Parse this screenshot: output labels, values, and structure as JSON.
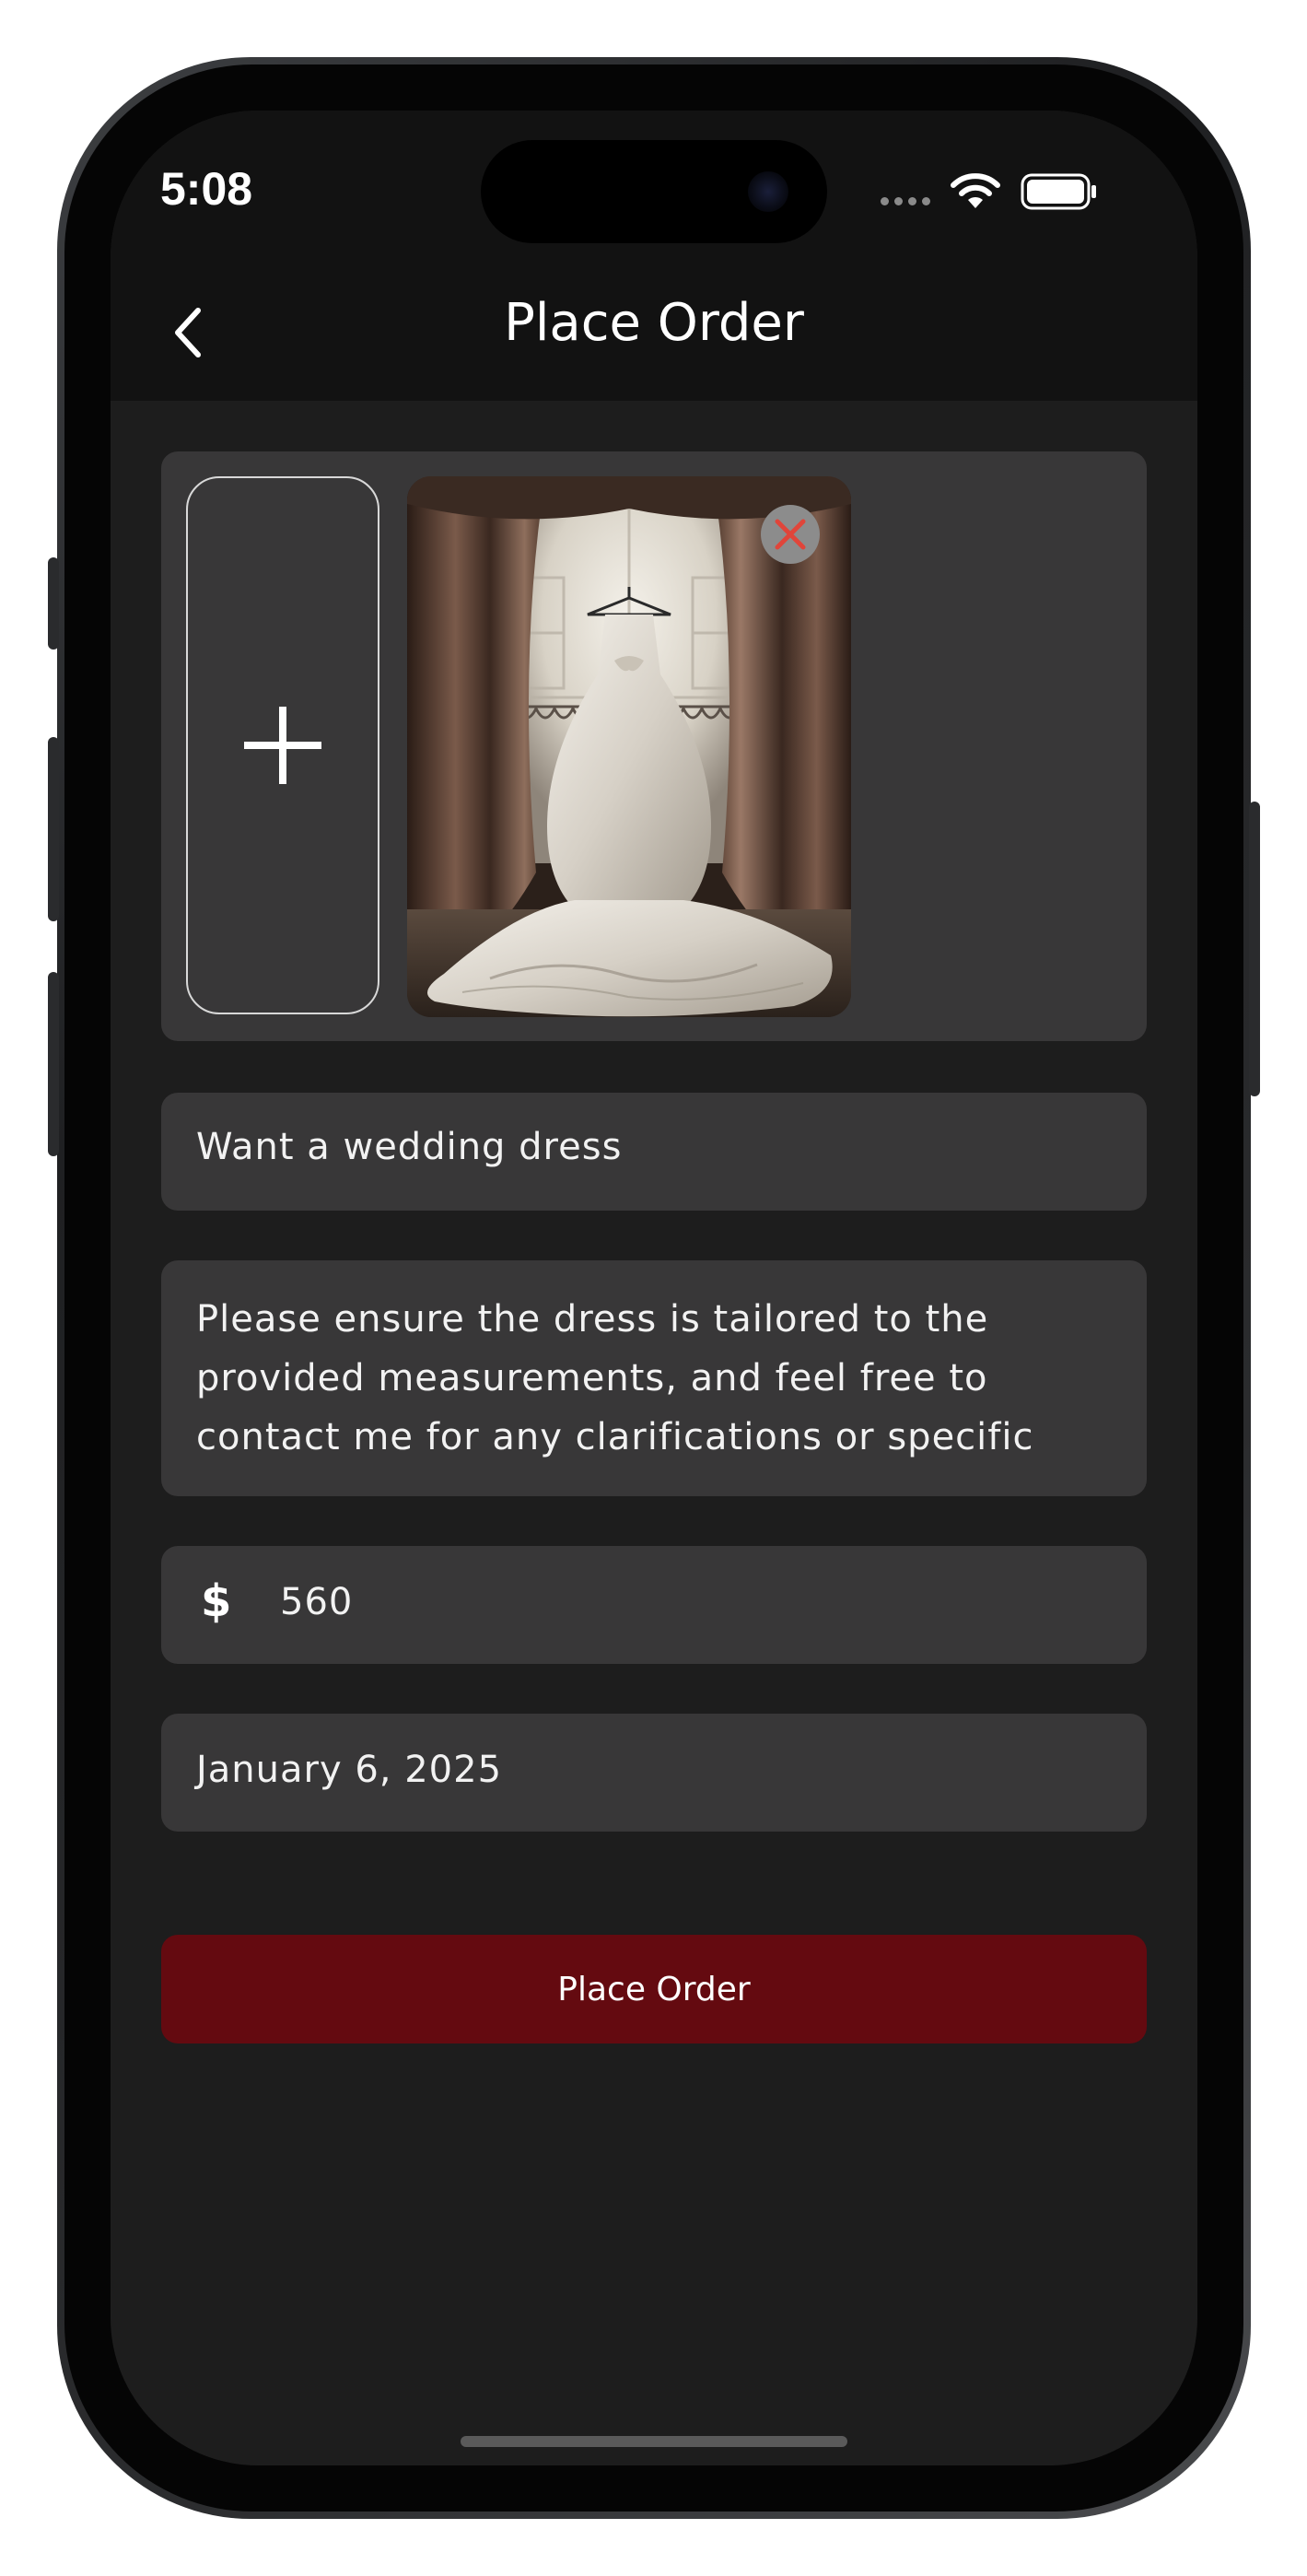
{
  "status_bar": {
    "time": "5:08",
    "icons": [
      "signal-dots-icon",
      "wifi-icon",
      "battery-icon"
    ]
  },
  "header": {
    "title": "Place Order",
    "back_icon": "chevron-left-icon"
  },
  "photos": {
    "add_icon": "plus-icon",
    "remove_icon": "close-icon",
    "items": [
      {
        "alt": "wedding dress hanging in front of arched window with curtains"
      }
    ]
  },
  "form": {
    "title_value": "Want a wedding dress",
    "description_value": "Please ensure the dress is tailored to the provided measurements, and feel free to contact me for any clarifications or specific",
    "currency_symbol": "$",
    "price_value": "560",
    "date_value": "January 6, 2025"
  },
  "actions": {
    "submit_label": "Place Order"
  },
  "colors": {
    "background": "#1d1d1d",
    "header": "#121212",
    "field": "#383738",
    "accent": "#640a10",
    "remove_x": "#e0453a"
  }
}
